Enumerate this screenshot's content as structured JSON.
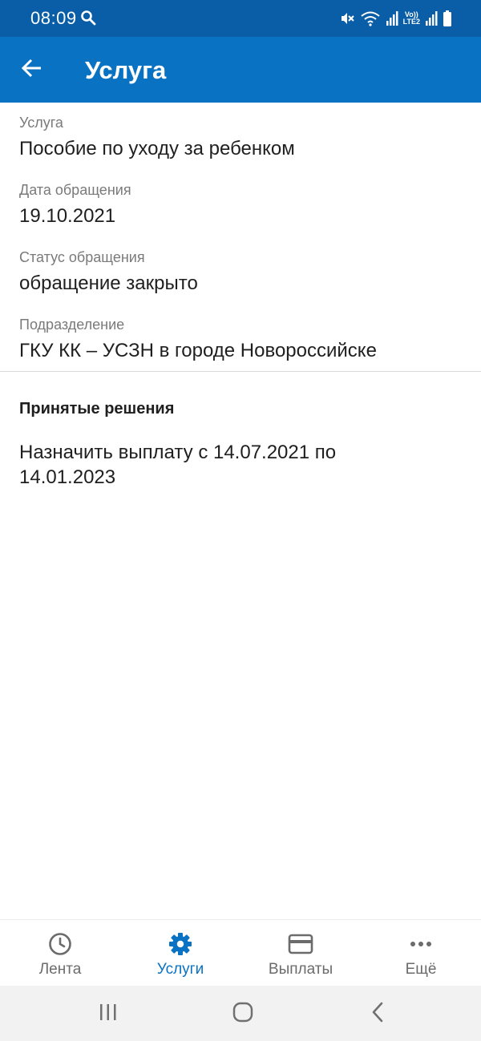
{
  "status_bar": {
    "time": "08:09",
    "network_label_top": "Vo))",
    "network_label_bottom": "LTE2"
  },
  "app_bar": {
    "title": "Услуга"
  },
  "details": {
    "service": {
      "label": "Услуга",
      "value": "Пособие по уходу за ребенком"
    },
    "request_date": {
      "label": "Дата обращения",
      "value": "19.10.2021"
    },
    "request_status": {
      "label": "Статус обращения",
      "value": "обращение закрыто"
    },
    "department": {
      "label": "Подразделение",
      "value": "ГКУ КК – УСЗН в городе Новороссийске"
    }
  },
  "decisions": {
    "heading": "Принятые решения",
    "text": "Назначить выплату с 14.07.2021 по 14.01.2023"
  },
  "bottom_nav": {
    "items": [
      {
        "label": "Лента",
        "icon": "clock-icon",
        "active": false
      },
      {
        "label": "Услуги",
        "icon": "gear-icon",
        "active": true
      },
      {
        "label": "Выплаты",
        "icon": "credit-card-icon",
        "active": false
      },
      {
        "label": "Ещё",
        "icon": "more-dots-icon",
        "active": false
      }
    ]
  },
  "colors": {
    "status_bar": "#0a5ea8",
    "app_bar": "#0a72c2",
    "accent": "#0a72c2",
    "nav_inactive": "#6b6b6b"
  }
}
